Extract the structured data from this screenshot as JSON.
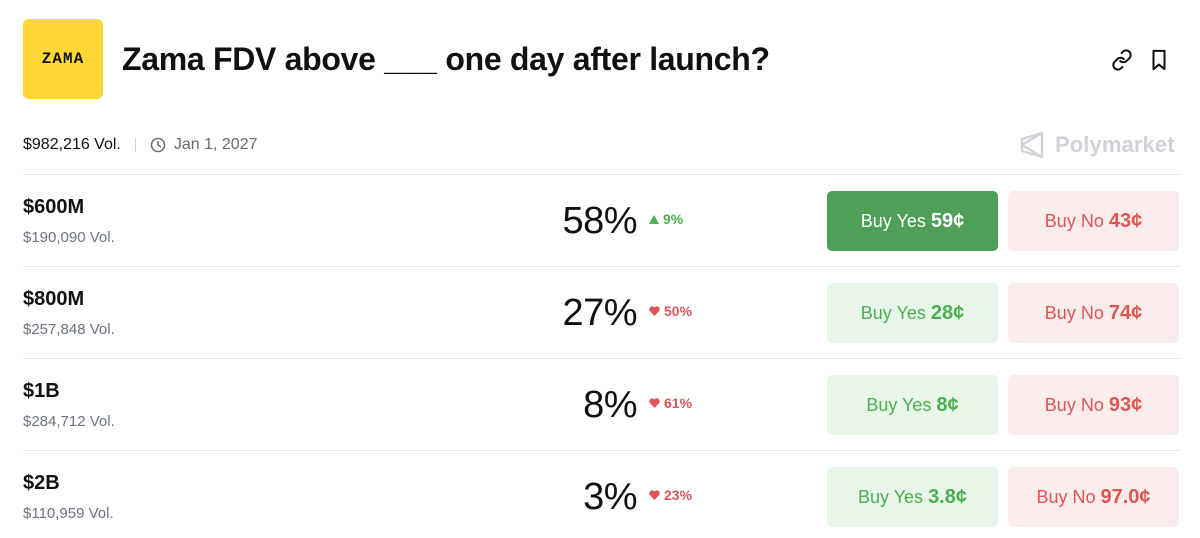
{
  "logo": {
    "text": "ZAMA",
    "color": "#fdd835"
  },
  "title": "Zama FDV above ___ one day after launch?",
  "header_icons": [
    "link-icon",
    "bookmark-icon"
  ],
  "meta": {
    "volume": "$982,216 Vol.",
    "end_date": "Jan 1, 2027"
  },
  "brand": {
    "name": "Polymarket"
  },
  "colors": {
    "yes": "#4caf50",
    "yes_active_bg": "#4e9f58",
    "yes_bg": "#e8f6ea",
    "no": "#e05555",
    "no_bg": "#fbecec"
  },
  "outcomes": [
    {
      "label": "$600M",
      "volume": "$190,090 Vol.",
      "chance": "58%",
      "change": "9%",
      "direction": "up",
      "yes_label": "Buy Yes",
      "yes_price": "59¢",
      "no_label": "Buy No",
      "no_price": "43¢",
      "yes_active": true
    },
    {
      "label": "$800M",
      "volume": "$257,848 Vol.",
      "chance": "27%",
      "change": "50%",
      "direction": "down",
      "yes_label": "Buy Yes",
      "yes_price": "28¢",
      "no_label": "Buy No",
      "no_price": "74¢",
      "yes_active": false
    },
    {
      "label": "$1B",
      "volume": "$284,712 Vol.",
      "chance": "8%",
      "change": "61%",
      "direction": "down",
      "yes_label": "Buy Yes",
      "yes_price": "8¢",
      "no_label": "Buy No",
      "no_price": "93¢",
      "yes_active": false
    },
    {
      "label": "$2B",
      "volume": "$110,959 Vol.",
      "chance": "3%",
      "change": "23%",
      "direction": "down",
      "yes_label": "Buy Yes",
      "yes_price": "3.8¢",
      "no_label": "Buy No",
      "no_price": "97.0¢",
      "yes_active": false
    }
  ]
}
